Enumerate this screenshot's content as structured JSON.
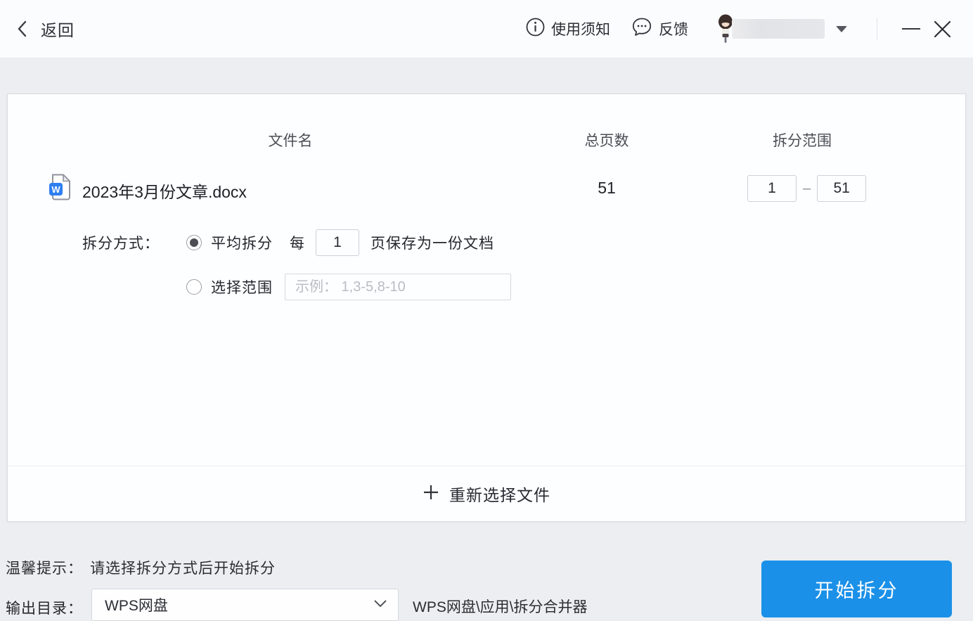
{
  "topbar": {
    "back_label": "返回",
    "usage_notice_label": "使用须知",
    "feedback_label": "反馈"
  },
  "file_table": {
    "headers": {
      "filename": "文件名",
      "total_pages": "总页数",
      "split_range": "拆分范围"
    },
    "file": {
      "name": "2023年3月份文章.docx",
      "total_pages": "51",
      "range_start": "1",
      "range_end": "51",
      "range_separator": "–"
    }
  },
  "split_method": {
    "label": "拆分方式：",
    "average": {
      "label": "平均拆分",
      "per_prefix": "每",
      "pages_value": "1",
      "per_suffix": "页保存为一份文档",
      "selected": true
    },
    "range": {
      "label": "选择范围",
      "placeholder": "示例： 1,3-5,8-10",
      "selected": false
    }
  },
  "reselect_label": "重新选择文件",
  "footer": {
    "tip_label": "温馨提示：",
    "tip_text": "请选择拆分方式后开始拆分",
    "output_label": "输出目录：",
    "output_value": "WPS网盘",
    "output_path": "WPS网盘\\应用\\拆分合并器",
    "start_button_label": "开始拆分"
  },
  "colors": {
    "accent_blue": "#1b90e8",
    "word_icon_blue": "#2d7ff0",
    "panel_background": "#fdfeff",
    "window_background": "#ecedf1"
  }
}
